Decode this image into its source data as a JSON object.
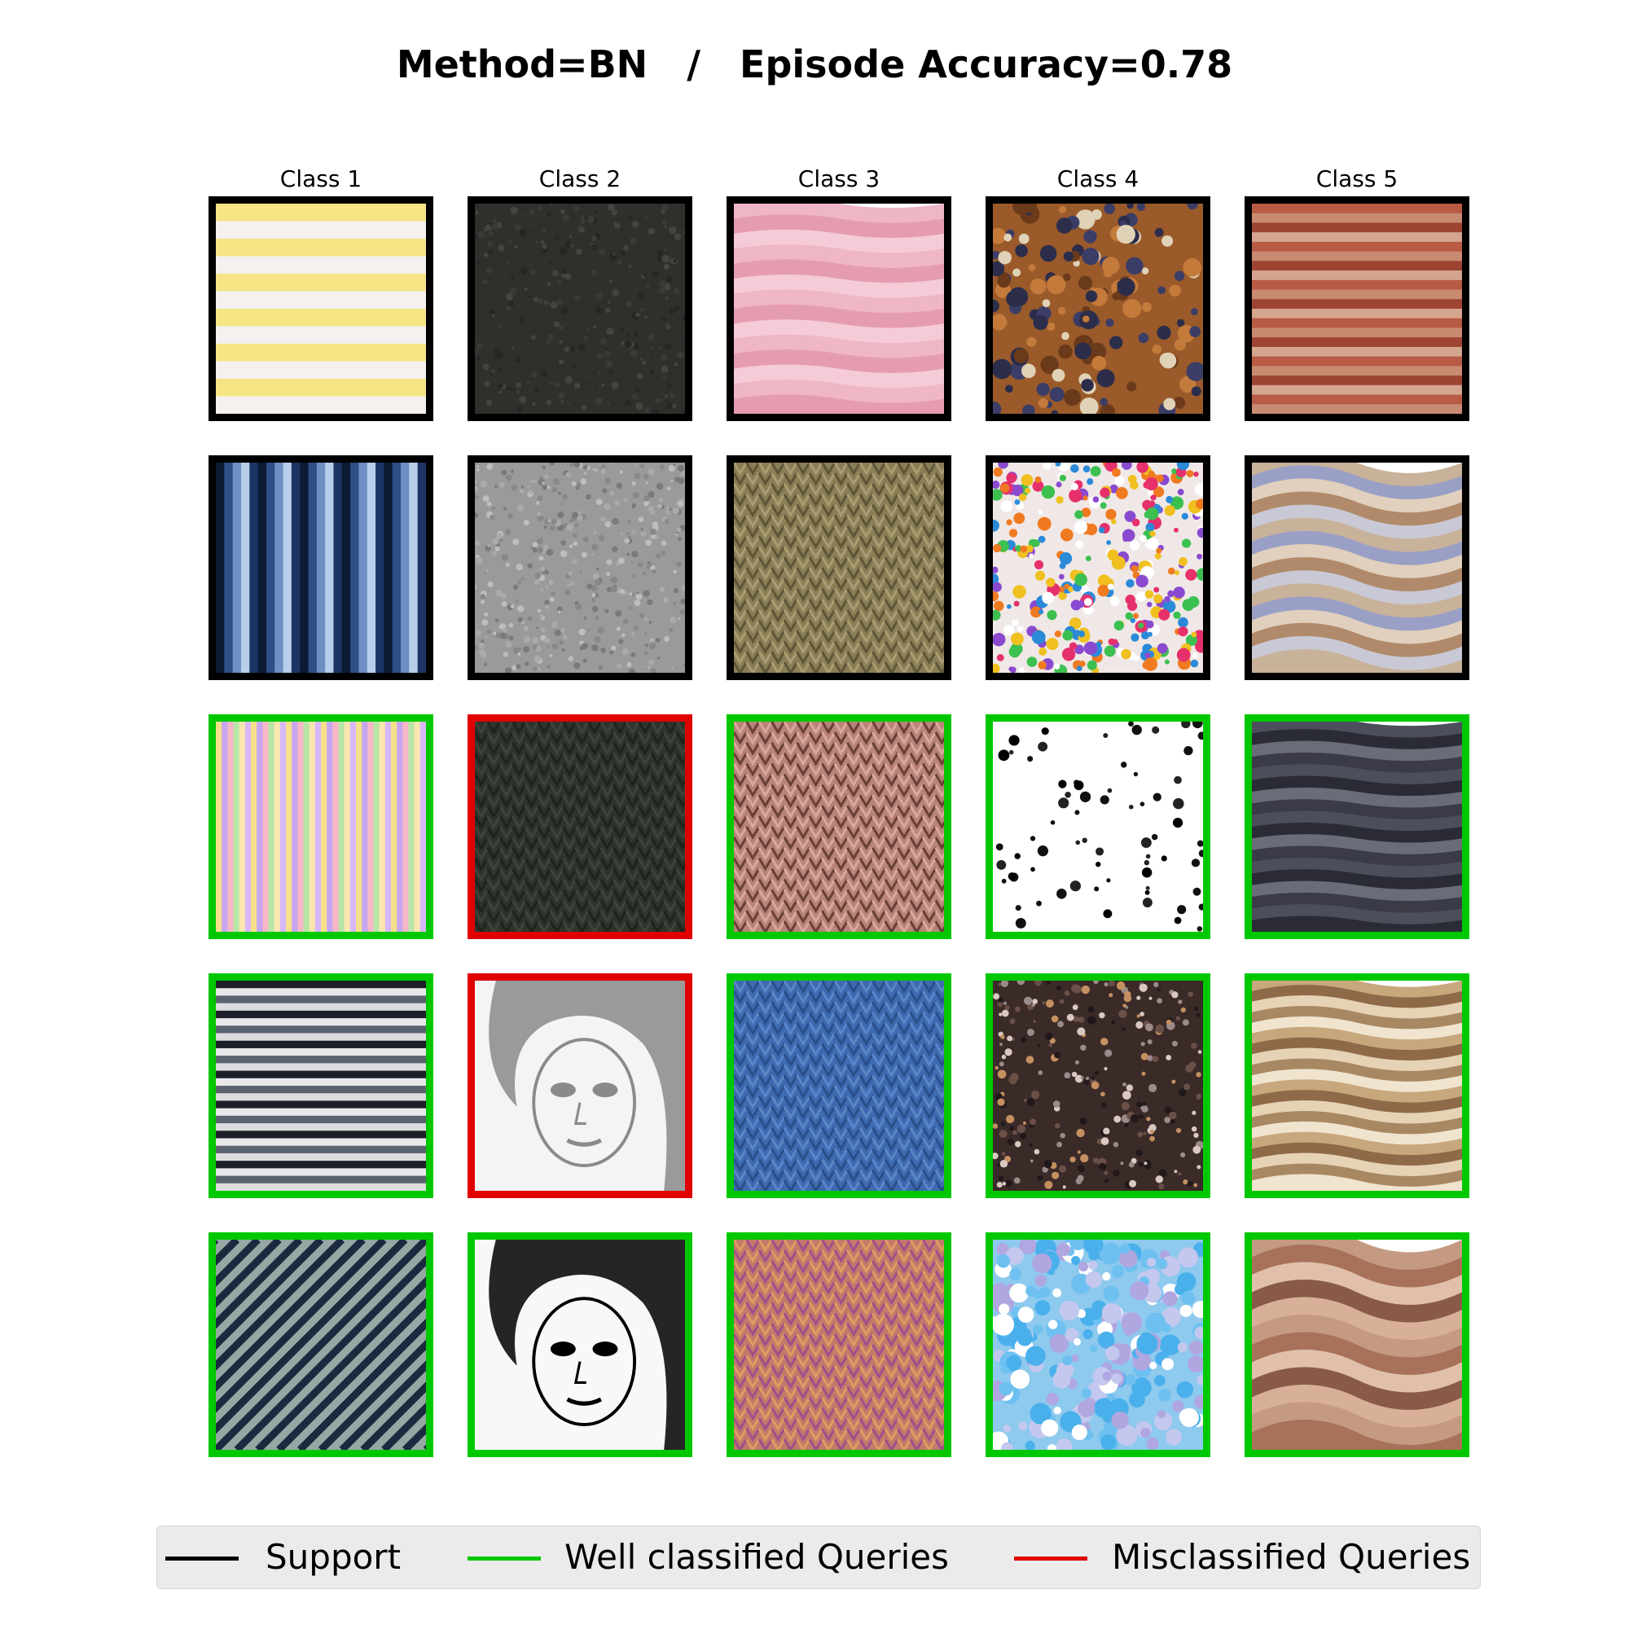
{
  "title": "Method=BN   /   Episode Accuracy=0.78",
  "classes": [
    "Class 1",
    "Class 2",
    "Class 3",
    "Class 4",
    "Class 5"
  ],
  "colors": {
    "support": "#000000",
    "well_classified": "#00c800",
    "misclassified": "#e00000"
  },
  "rows": [
    [
      "support",
      "support",
      "support",
      "support",
      "support"
    ],
    [
      "support",
      "support",
      "support",
      "support",
      "support"
    ],
    [
      "well_classified",
      "misclassified",
      "well_classified",
      "well_classified",
      "well_classified"
    ],
    [
      "well_classified",
      "misclassified",
      "well_classified",
      "well_classified",
      "well_classified"
    ],
    [
      "well_classified",
      "well_classified",
      "well_classified",
      "well_classified",
      "well_classified"
    ]
  ],
  "tiles": [
    [
      "yellow-stripes",
      "dark-fabric",
      "pink-ruffles",
      "brown-blueberries",
      "red-brick"
    ],
    [
      "blue-vertical-stripes",
      "grey-noise",
      "olive-knit-lace",
      "rainbow-sprinkles",
      "marbled-rock"
    ],
    [
      "pastel-vertical-stripes",
      "dark-knit",
      "pink-cable-knit",
      "ink-splatter",
      "dark-layered-rock"
    ],
    [
      "black-white-stripes",
      "sketch-portrait-1",
      "blue-knit",
      "milky-way",
      "banded-agate"
    ],
    [
      "diagonal-stripes",
      "sketch-portrait-2",
      "orange-knit",
      "watercolor-sky",
      "sandstone-rock"
    ]
  ],
  "legend": [
    {
      "key": "support",
      "label": "Support"
    },
    {
      "key": "well_classified",
      "label": "Well classified Queries"
    },
    {
      "key": "misclassified",
      "label": "Misclassified Queries"
    }
  ]
}
